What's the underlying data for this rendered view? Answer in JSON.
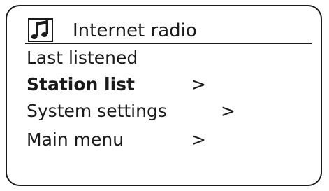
{
  "header": {
    "title": "Internet radio",
    "icon": "music-note-icon"
  },
  "menu": {
    "items": [
      {
        "label": "Last listened",
        "arrow": "",
        "selected": false
      },
      {
        "label": "Station list",
        "arrow": ">",
        "selected": true
      },
      {
        "label": "System settings",
        "arrow": ">",
        "selected": false
      },
      {
        "label": "Main menu",
        "arrow": ">",
        "selected": false
      }
    ]
  }
}
